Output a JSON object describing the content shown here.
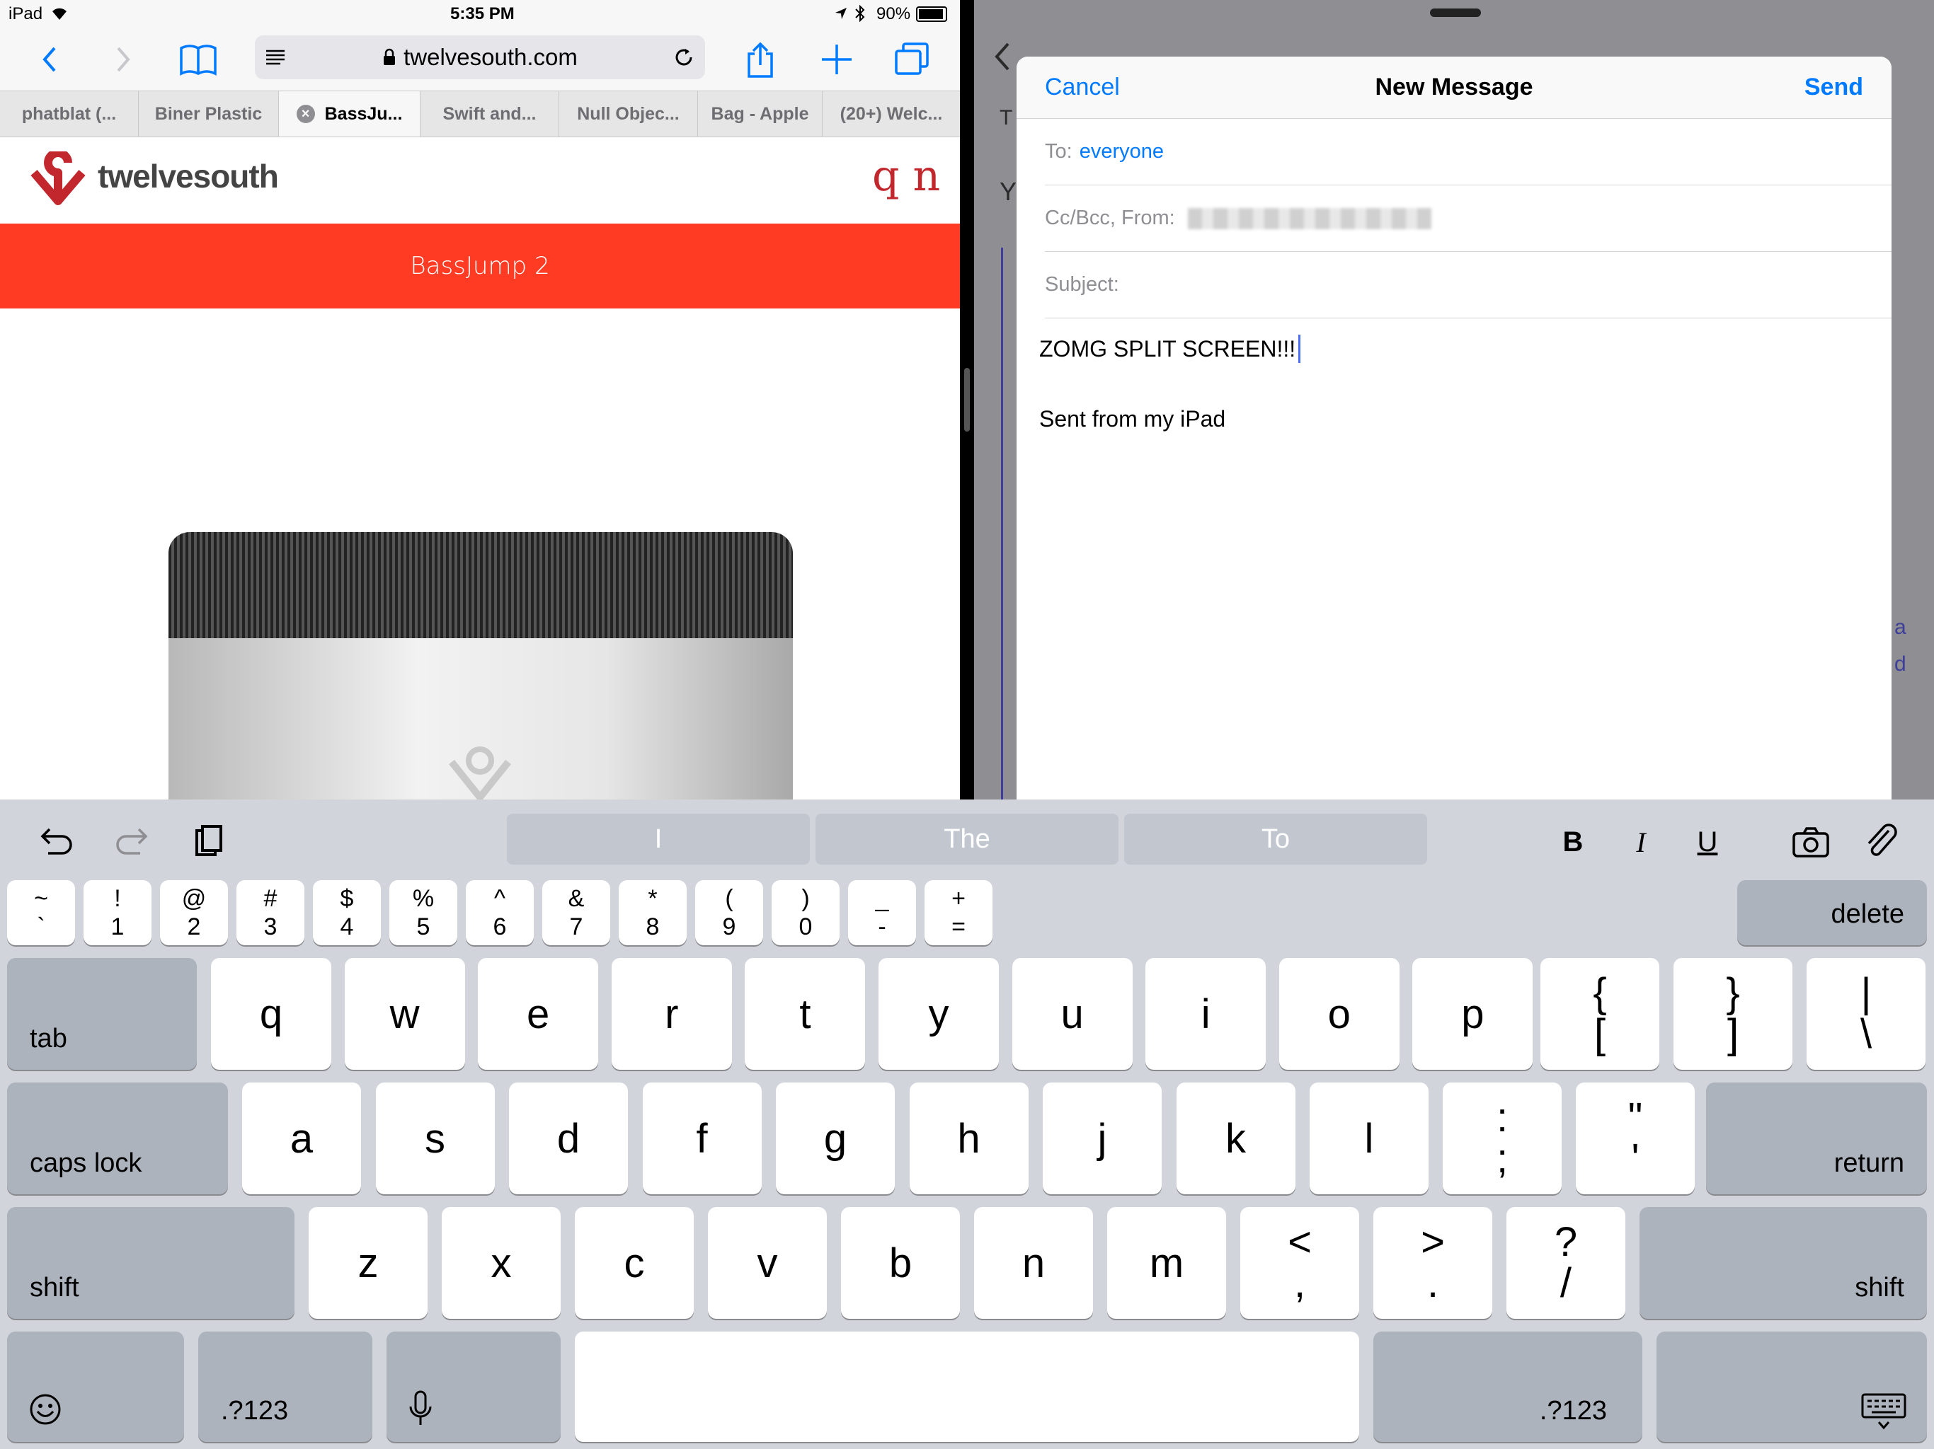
{
  "status": {
    "device": "iPad",
    "time": "5:35 PM",
    "battery": "90%"
  },
  "safari": {
    "url": "twelvesouth.com",
    "tabs": [
      "phatblat (...",
      "Biner Plastic",
      "BassJu...",
      "Swift and...",
      "Null Objec...",
      "Bag - Apple",
      "(20+) Welc..."
    ],
    "active_tab": 2,
    "site_logo": "twelvesouth",
    "header_glyphs": "q n",
    "banner": "BassJump 2"
  },
  "mail": {
    "cancel": "Cancel",
    "title": "New Message",
    "send": "Send",
    "to_label": "To:",
    "to_value": "everyone",
    "ccbcc_label": "Cc/Bcc, From:",
    "subject_label": "Subject:",
    "body_line1": "ZOMG SPLIT SCREEN!!!",
    "signature": "Sent from my iPad",
    "bg_fragments": [
      "T",
      "Y",
      "a",
      "d"
    ]
  },
  "keyboard": {
    "suggestions": [
      "I",
      "The",
      "To"
    ],
    "format": {
      "bold": "B",
      "italic": "I",
      "underline": "U"
    },
    "number_row": [
      {
        "top": "~",
        "bottom": "`"
      },
      {
        "top": "!",
        "bottom": "1"
      },
      {
        "top": "@",
        "bottom": "2"
      },
      {
        "top": "#",
        "bottom": "3"
      },
      {
        "top": "$",
        "bottom": "4"
      },
      {
        "top": "%",
        "bottom": "5"
      },
      {
        "top": "^",
        "bottom": "6"
      },
      {
        "top": "&",
        "bottom": "7"
      },
      {
        "top": "*",
        "bottom": "8"
      },
      {
        "top": "(",
        "bottom": "9"
      },
      {
        "top": ")",
        "bottom": "0"
      },
      {
        "top": "_",
        "bottom": "-"
      },
      {
        "top": "+",
        "bottom": "="
      }
    ],
    "delete": "delete",
    "tab": "tab",
    "row_q": [
      "q",
      "w",
      "e",
      "r",
      "t",
      "y",
      "u",
      "i",
      "o",
      "p"
    ],
    "row_q_extra": [
      {
        "top": "{",
        "bottom": "["
      },
      {
        "top": "}",
        "bottom": "]"
      },
      {
        "top": "|",
        "bottom": "\\"
      }
    ],
    "caps": "caps lock",
    "row_a": [
      "a",
      "s",
      "d",
      "f",
      "g",
      "h",
      "j",
      "k",
      "l"
    ],
    "row_a_extra": [
      {
        "top": ":",
        "bottom": ";"
      },
      {
        "top": "\"",
        "bottom": "'"
      }
    ],
    "return": "return",
    "shift": "shift",
    "row_z": [
      "z",
      "x",
      "c",
      "v",
      "b",
      "n",
      "m"
    ],
    "row_z_extra": [
      {
        "top": "<",
        "bottom": ","
      },
      {
        "top": ">",
        "bottom": "."
      },
      {
        "top": "?",
        "bottom": "/"
      }
    ],
    "numbers_key": ".?123"
  },
  "colors": {
    "accent": "#007aff",
    "banner": "#ff3b24",
    "logo": "#c1272d"
  }
}
